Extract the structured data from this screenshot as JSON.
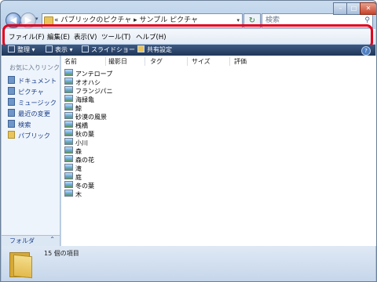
{
  "window": {
    "address_path": "« パブリックのピクチャ ▸ サンプル ピクチャ",
    "search_placeholder": "検索",
    "controls": {
      "minimize": "–",
      "maximize": "□",
      "close": "✕"
    }
  },
  "menubar": [
    "ファイル(F)",
    "編集(E)",
    "表示(V)",
    "ツール(T)",
    "ヘルプ(H)"
  ],
  "toolbar": {
    "organize": "整理 ▾",
    "views": "表示 ▾",
    "slideshow": "スライドショー",
    "share": "共有設定"
  },
  "navpane": {
    "title": "お気に入りリンク",
    "items": [
      "ドキュメント",
      "ピクチャ",
      "ミュージック",
      "最近の変更",
      "検索",
      "パブリック"
    ],
    "folder_label": "フォルダ"
  },
  "columns": [
    "名前",
    "撮影日",
    "タグ",
    "サイズ",
    "評価"
  ],
  "files": [
    "アンテロープ",
    "オオハシ",
    "フランジパニ",
    "海緑亀",
    "鯨",
    "砂漠の風景",
    "桟橋",
    "秋の葉",
    "小川",
    "森",
    "森の花",
    "滝",
    "庭",
    "冬の葉",
    "木"
  ],
  "details": {
    "count_text": "15 個の項目"
  },
  "colors": {
    "highlight": "#e0001a",
    "toolbar_bg": "#1f3658",
    "link": "#1a3f8c"
  }
}
